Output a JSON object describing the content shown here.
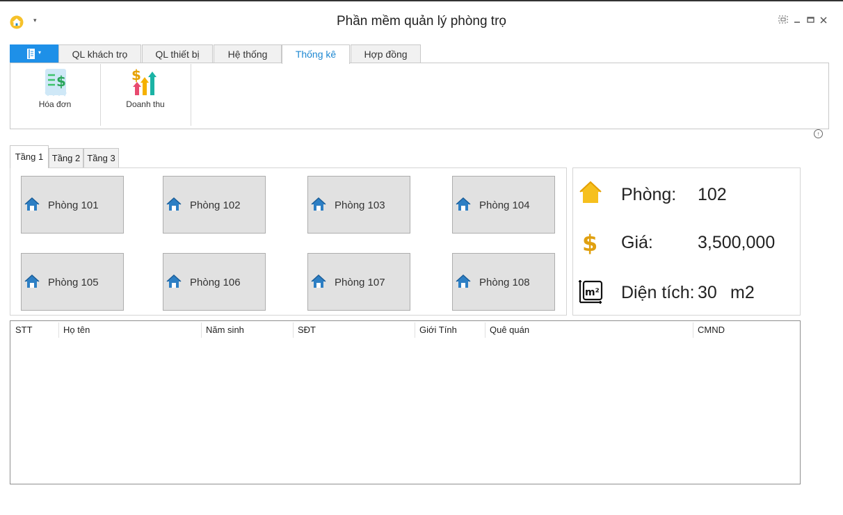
{
  "window": {
    "title": "Phần mềm quản lý phòng trọ",
    "app_icon": "home-icon",
    "controls": [
      "restore-icon",
      "minimize-icon",
      "maximize-icon",
      "close-icon"
    ]
  },
  "ribbon": {
    "menu_icon": "book-icon",
    "tabs": [
      "QL khách trọ",
      "QL thiết bị",
      "Hệ thống",
      "Thống kê",
      "Hợp đồng"
    ],
    "active_tab": "Thống kê",
    "buttons": [
      {
        "label": "Hóa đơn",
        "icon": "invoice-icon"
      },
      {
        "label": "Doanh thu",
        "icon": "revenue-icon"
      }
    ]
  },
  "floors": {
    "tabs": [
      "Tầng 1",
      "Tầng 2",
      "Tầng 3"
    ],
    "active": "Tầng 1",
    "rooms": [
      "Phòng 101",
      "Phòng 102",
      "Phòng 103",
      "Phòng 104",
      "Phòng 105",
      "Phòng 106",
      "Phòng 107",
      "Phòng 108"
    ]
  },
  "info": {
    "room_label": "Phòng:",
    "room_value": "102",
    "price_label": "Giá:",
    "price_value": "3,500,000",
    "area_label": "Diện tích:",
    "area_value": "30",
    "area_unit": "m2"
  },
  "grid": {
    "columns": [
      "STT",
      "Họ tên",
      "Năm sinh",
      "SĐT",
      "Giới Tính",
      "Quê quán",
      "CMND"
    ],
    "rows": []
  },
  "colors": {
    "accent": "#1e90e8",
    "active_tab_text": "#1e88d2",
    "room_button": "#e1e1e1"
  }
}
